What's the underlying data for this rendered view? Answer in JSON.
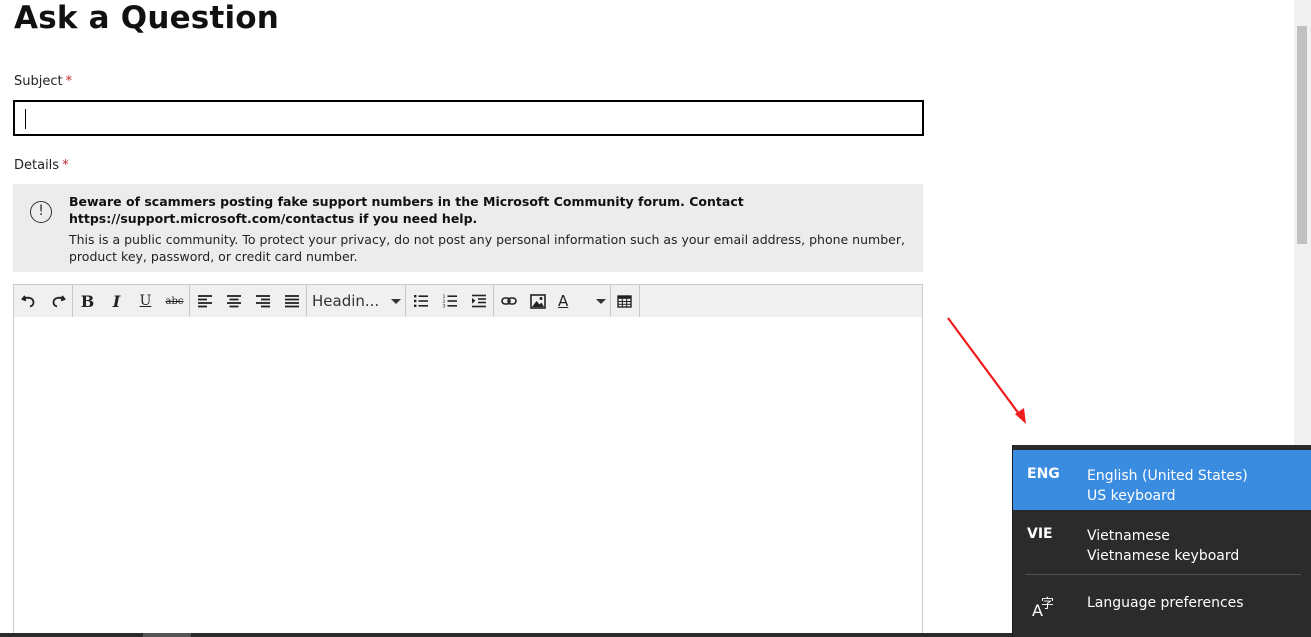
{
  "page": {
    "title": "Ask a Question"
  },
  "subject": {
    "label": "Subject",
    "required_mark": "*",
    "value": ""
  },
  "details": {
    "label": "Details",
    "required_mark": "*"
  },
  "notice": {
    "icon": "info-circle-icon",
    "warning": "Beware of scammers posting fake support numbers in the Microsoft Community forum. Contact https://support.microsoft.com/contactus if you need help.",
    "privacy": "This is a public community. To protect your privacy, do not post any personal information such as your email address, phone number, product key, password, or credit card number."
  },
  "toolbar": {
    "bold_label": "B",
    "italic_label": "I",
    "underline_label": "U",
    "strike_label": "abc",
    "heading_select": "Headin...",
    "font_color_label": "A",
    "buttons": [
      "undo",
      "redo",
      "bold",
      "italic",
      "underline",
      "strikethrough",
      "align-left",
      "align-center",
      "align-right",
      "justify",
      "heading",
      "bullet-list",
      "numbered-list",
      "indent",
      "link",
      "image",
      "font-color",
      "table"
    ]
  },
  "language_flyout": {
    "items": [
      {
        "code": "ENG",
        "name": "English (United States)",
        "keyboard": "US keyboard",
        "selected": true
      },
      {
        "code": "VIE",
        "name": "Vietnamese",
        "keyboard": "Vietnamese keyboard",
        "selected": false
      }
    ],
    "preferences_label": "Language preferences",
    "preferences_icon": "language-icon",
    "highlight_color": "#3a8ce0",
    "background_color": "#2b2b2b"
  },
  "annotation": {
    "arrow_color": "#ee1c1c"
  }
}
